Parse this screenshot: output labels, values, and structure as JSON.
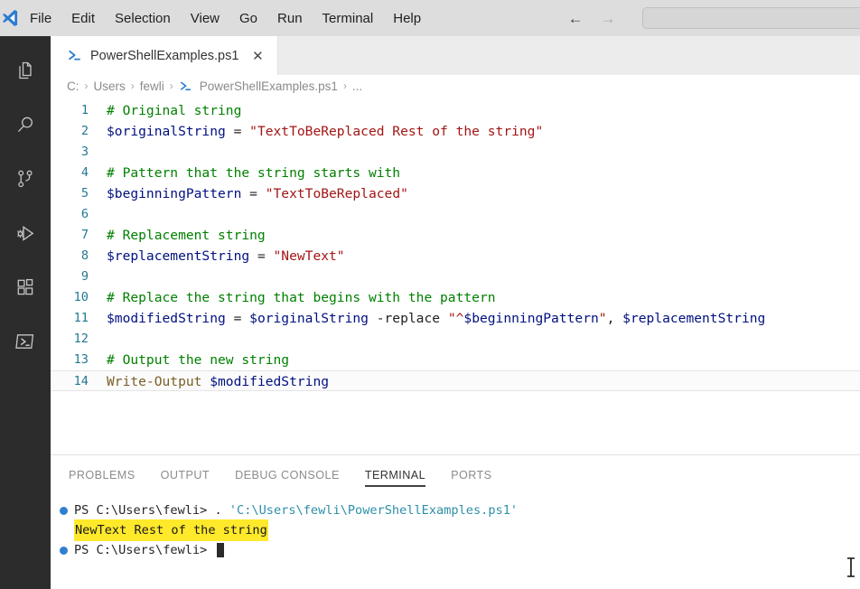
{
  "titlebar": {
    "logo_icon": "vscode-logo-icon",
    "menus": [
      "File",
      "Edit",
      "Selection",
      "View",
      "Go",
      "Run",
      "Terminal",
      "Help"
    ],
    "nav_back_icon": "arrow-left-icon",
    "nav_forward_icon": "arrow-right-icon",
    "nav_back_glyph": "←",
    "nav_forward_glyph": "→",
    "command_center_value": ""
  },
  "activitybar": {
    "items": [
      {
        "name": "explorer",
        "icon": "files-icon"
      },
      {
        "name": "search",
        "icon": "search-icon"
      },
      {
        "name": "source-control",
        "icon": "source-control-icon"
      },
      {
        "name": "run-and-debug",
        "icon": "run-debug-icon"
      },
      {
        "name": "extensions",
        "icon": "extensions-icon"
      },
      {
        "name": "powershell-terminal",
        "icon": "terminal-icon"
      }
    ]
  },
  "editor": {
    "tab": {
      "icon": "powershell-file-icon",
      "label": "PowerShellExamples.ps1",
      "close_glyph": "✕"
    },
    "breadcrumbs": [
      {
        "label": "C:",
        "icon": null
      },
      {
        "label": "Users",
        "icon": null
      },
      {
        "label": "fewli",
        "icon": null
      },
      {
        "label": "PowerShellExamples.ps1",
        "icon": "powershell-file-icon"
      },
      {
        "label": "...",
        "icon": null
      }
    ],
    "breadcrumb_separator": "›",
    "active_line": 14,
    "lines": [
      {
        "n": "1",
        "tokens": [
          {
            "t": "# Original string",
            "c": "comment"
          }
        ]
      },
      {
        "n": "2",
        "tokens": [
          {
            "t": "$originalString",
            "c": "var"
          },
          {
            "t": " = ",
            "c": "op"
          },
          {
            "t": "\"TextToBeReplaced Rest of the string\"",
            "c": "str"
          }
        ]
      },
      {
        "n": "3",
        "tokens": []
      },
      {
        "n": "4",
        "tokens": [
          {
            "t": "# Pattern that the string starts with",
            "c": "comment"
          }
        ]
      },
      {
        "n": "5",
        "tokens": [
          {
            "t": "$beginningPattern",
            "c": "var"
          },
          {
            "t": " = ",
            "c": "op"
          },
          {
            "t": "\"TextToBeReplaced\"",
            "c": "str"
          }
        ]
      },
      {
        "n": "6",
        "tokens": []
      },
      {
        "n": "7",
        "tokens": [
          {
            "t": "# Replacement string",
            "c": "comment"
          }
        ]
      },
      {
        "n": "8",
        "tokens": [
          {
            "t": "$replacementString",
            "c": "var"
          },
          {
            "t": " = ",
            "c": "op"
          },
          {
            "t": "\"NewText\"",
            "c": "str"
          }
        ]
      },
      {
        "n": "9",
        "tokens": []
      },
      {
        "n": "10",
        "tokens": [
          {
            "t": "# Replace the string that begins with the pattern",
            "c": "comment"
          }
        ]
      },
      {
        "n": "11",
        "tokens": [
          {
            "t": "$modifiedString",
            "c": "var"
          },
          {
            "t": " = ",
            "c": "op"
          },
          {
            "t": "$originalString",
            "c": "var"
          },
          {
            "t": " -replace ",
            "c": "plain"
          },
          {
            "t": "\"^",
            "c": "str"
          },
          {
            "t": "$beginningPattern",
            "c": "var"
          },
          {
            "t": "\"",
            "c": "str"
          },
          {
            "t": ", ",
            "c": "plain"
          },
          {
            "t": "$replacementString",
            "c": "var"
          }
        ]
      },
      {
        "n": "12",
        "tokens": []
      },
      {
        "n": "13",
        "tokens": [
          {
            "t": "# Output the new string",
            "c": "comment"
          }
        ]
      },
      {
        "n": "14",
        "tokens": [
          {
            "t": "Write-Output",
            "c": "cmd"
          },
          {
            "t": " ",
            "c": "plain"
          },
          {
            "t": "$modifiedString",
            "c": "var"
          }
        ]
      }
    ]
  },
  "panel": {
    "tabs": [
      {
        "label": "PROBLEMS",
        "active": false
      },
      {
        "label": "OUTPUT",
        "active": false
      },
      {
        "label": "DEBUG CONSOLE",
        "active": false
      },
      {
        "label": "TERMINAL",
        "active": true
      },
      {
        "label": "PORTS",
        "active": false
      }
    ],
    "terminal": {
      "rows": [
        {
          "marker": true,
          "segments": [
            {
              "t": "PS C:\\Users\\fewli> . ",
              "c": "prompt"
            },
            {
              "t": "'C:\\Users\\fewli\\PowerShellExamples.ps1'",
              "c": "path"
            }
          ]
        },
        {
          "marker": false,
          "segments": [
            {
              "t": "NewText Rest of the string",
              "c": "highlight"
            }
          ]
        },
        {
          "marker": true,
          "segments": [
            {
              "t": "PS C:\\Users\\fewli> ",
              "c": "prompt"
            }
          ],
          "cursor": true
        }
      ]
    }
  },
  "cursor": {
    "icon": "text-ibeam-cursor"
  },
  "colors": {
    "titlebar_bg": "#dddddd",
    "activitybar_bg": "#2c2c2c",
    "editor_bg": "#ffffff",
    "tabbar_bg": "#ececec",
    "line_number": "#237893",
    "comment": "#008000",
    "variable": "#001080",
    "string": "#a31515",
    "cmdlet": "#795e26",
    "terminal_path": "#2d8fa8",
    "terminal_marker": "#2f7fd1",
    "highlight": "#ffe92b"
  }
}
